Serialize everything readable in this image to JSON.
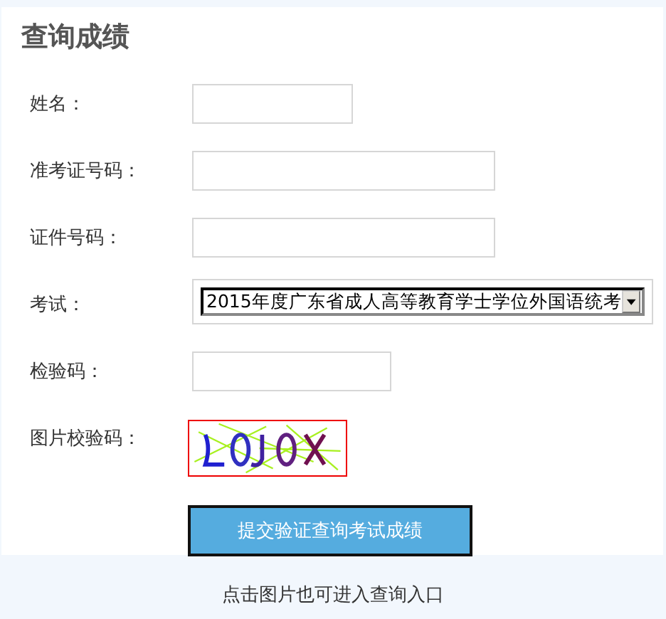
{
  "title": "查询成绩",
  "fields": [
    {
      "label": "姓名：",
      "kind": "text"
    },
    {
      "label": "准考证号码：",
      "kind": "text"
    },
    {
      "label": "证件号码：",
      "kind": "text"
    },
    {
      "label": "考试：",
      "kind": "select",
      "value": "2015年度广东省成人高等教育学士学位外国语统考"
    },
    {
      "label": "检验码：",
      "kind": "text"
    },
    {
      "label": "图片校验码：",
      "kind": "captcha"
    }
  ],
  "submit": "提交验证查询考试成绩",
  "footer": "点击图片也可进入查询入口"
}
